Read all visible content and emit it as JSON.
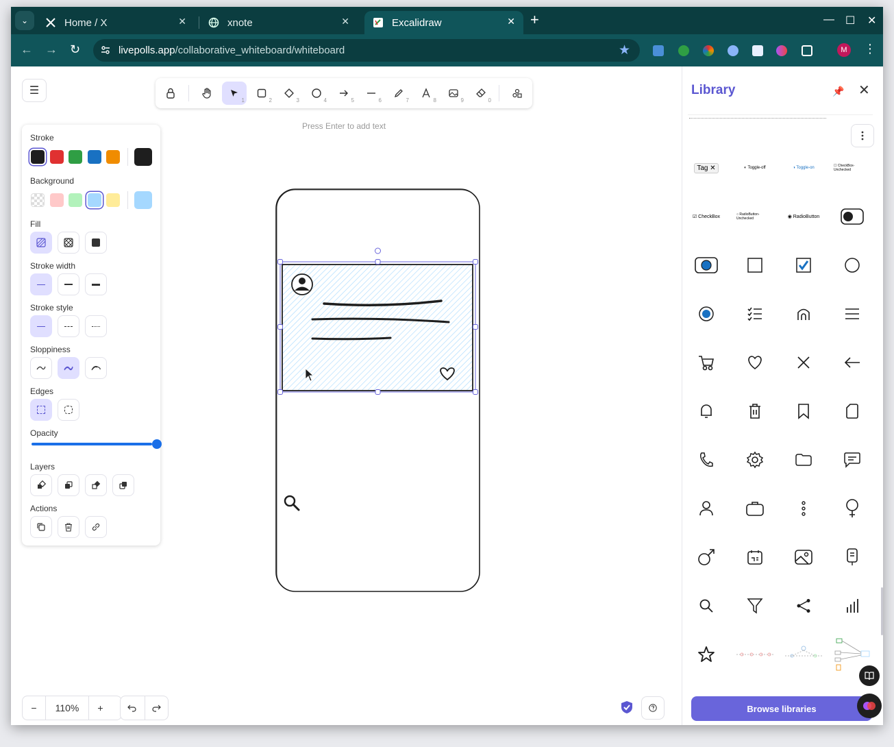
{
  "browser": {
    "tabs": [
      {
        "title": "Home / X",
        "favicon": "x-logo-icon"
      },
      {
        "title": "xnote",
        "favicon": "globe-icon"
      },
      {
        "title": "Excalidraw",
        "favicon": "excalidraw-icon"
      }
    ],
    "url_host": "livepolls.app",
    "url_path": "/collaborative_whiteboard/whiteboard",
    "profile_initial": "M"
  },
  "toolbar": {
    "tools": [
      {
        "name": "lock-icon",
        "key": ""
      },
      {
        "name": "hand-icon",
        "key": ""
      },
      {
        "name": "selection-icon",
        "key": "1"
      },
      {
        "name": "rectangle-icon",
        "key": "2"
      },
      {
        "name": "diamond-icon",
        "key": "3"
      },
      {
        "name": "ellipse-icon",
        "key": "4"
      },
      {
        "name": "arrow-icon",
        "key": "5"
      },
      {
        "name": "line-icon",
        "key": "6"
      },
      {
        "name": "pencil-icon",
        "key": "7"
      },
      {
        "name": "text-icon",
        "key": "8"
      },
      {
        "name": "image-icon",
        "key": "9"
      },
      {
        "name": "eraser-icon",
        "key": "0"
      },
      {
        "name": "shapes-icon",
        "key": ""
      }
    ],
    "active_tool": "selection-icon",
    "hint": "Press Enter to add text"
  },
  "properties": {
    "stroke_label": "Stroke",
    "stroke_colors": [
      "#1e1e1e",
      "#e03131",
      "#2f9e44",
      "#1971c2",
      "#f08c00"
    ],
    "stroke_current": "#1e1e1e",
    "background_label": "Background",
    "background_colors": [
      "transparent",
      "#ffc9c9",
      "#b2f2bb",
      "#a5d8ff",
      "#ffec99"
    ],
    "background_current": "#a5d8ff",
    "fill_label": "Fill",
    "stroke_width_label": "Stroke width",
    "stroke_style_label": "Stroke style",
    "sloppiness_label": "Sloppiness",
    "edges_label": "Edges",
    "opacity_label": "Opacity",
    "opacity_value": 100,
    "layers_label": "Layers",
    "actions_label": "Actions"
  },
  "footer": {
    "zoom_level": "110%",
    "zoom_out": "−",
    "zoom_in": "+"
  },
  "library": {
    "title": "Library",
    "browse_label": "Browse libraries",
    "items": [
      "tag-chip",
      "toggle-off",
      "toggle-on",
      "checkbox-unchecked-text",
      "checkbox-text",
      "radio-unchecked-text",
      "radio-button-text",
      "toggle-switch",
      "radio-selected-box",
      "square",
      "checkbox-checked",
      "circle",
      "radio-selected",
      "list-icon",
      "home-icon",
      "menu-icon",
      "cart-icon",
      "heart-icon",
      "close-icon",
      "back-arrow-icon",
      "bell-icon",
      "trash-icon",
      "bookmark-icon",
      "file-icon",
      "phone-icon",
      "settings-icon",
      "folder-icon",
      "chat-icon",
      "user-icon",
      "briefcase-icon",
      "more-vertical-icon",
      "female-icon",
      "male-icon",
      "calendar-icon",
      "image-icon",
      "mobile-icon",
      "search-icon",
      "filter-icon",
      "share-icon",
      "bar-chart-icon",
      "star-icon",
      "flow-sketch-1",
      "flow-sketch-2",
      "flow-sketch-3"
    ]
  }
}
